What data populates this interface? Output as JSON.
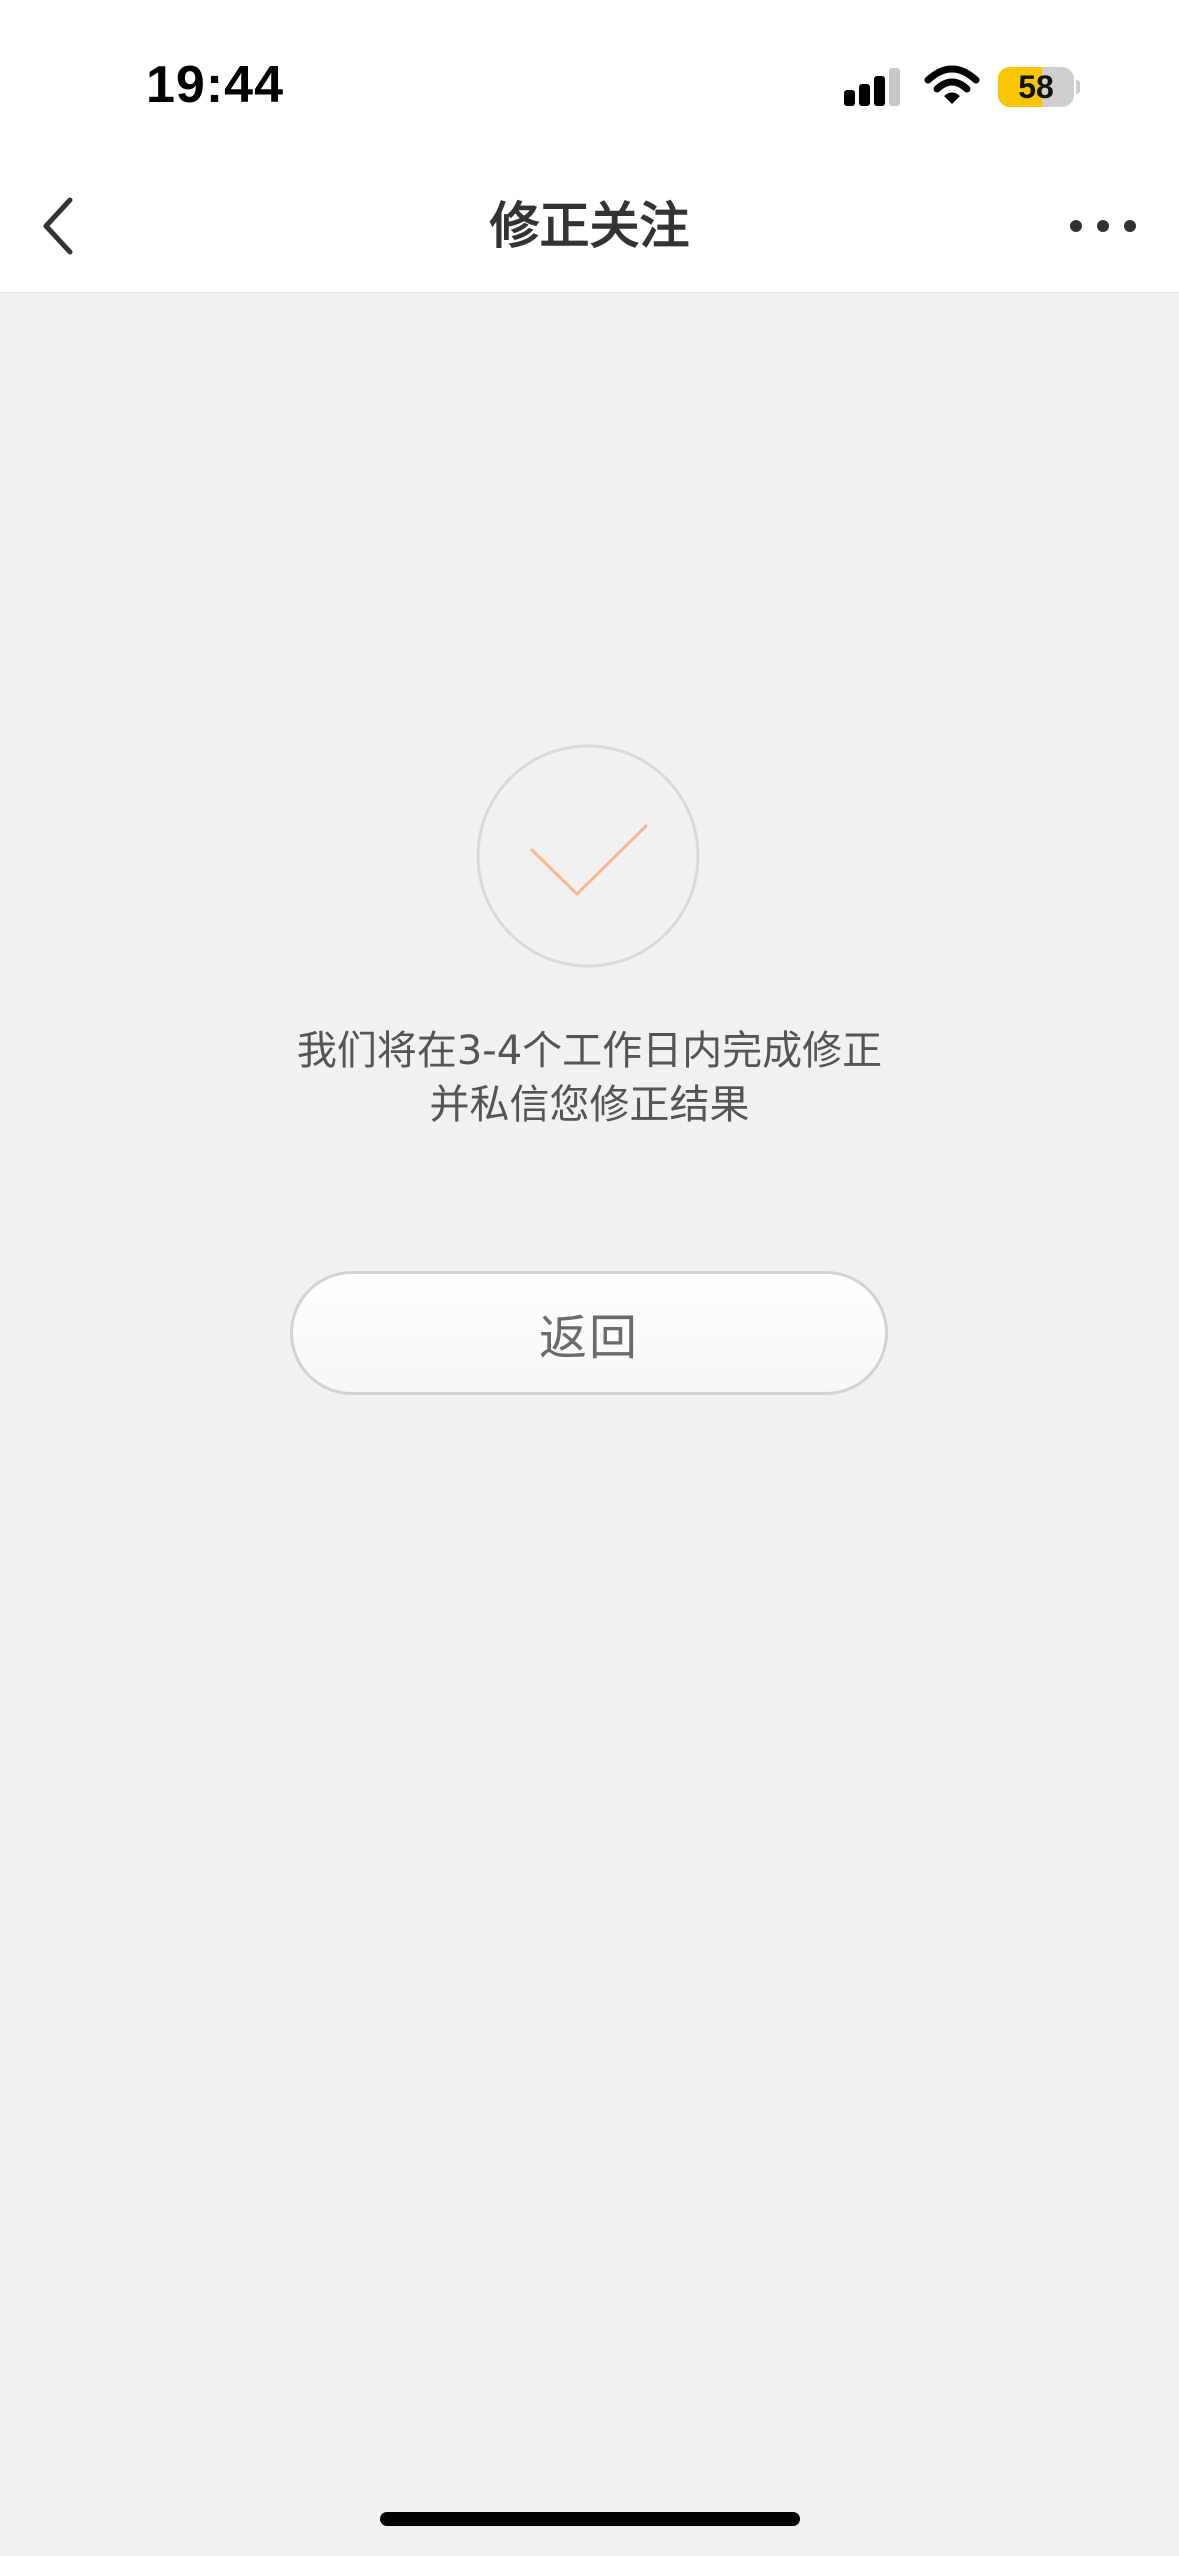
{
  "status_bar": {
    "time": "19:44",
    "battery_level": "58",
    "battery_fraction": 0.58,
    "icons": [
      "signal-icon",
      "wifi-icon",
      "battery-icon"
    ]
  },
  "nav": {
    "title": "修正关注",
    "back_icon": "chevron-left-icon",
    "more_icon": "more-dots-icon"
  },
  "result": {
    "icon": "check-circle-icon",
    "message_line1": "我们将在3-4个工作日内完成修正",
    "message_line2": "并私信您修正结果",
    "return_label": "返回"
  },
  "colors": {
    "background": "#f1f1f1",
    "check_accent": "#f7b98f",
    "battery": "#f7c600"
  }
}
